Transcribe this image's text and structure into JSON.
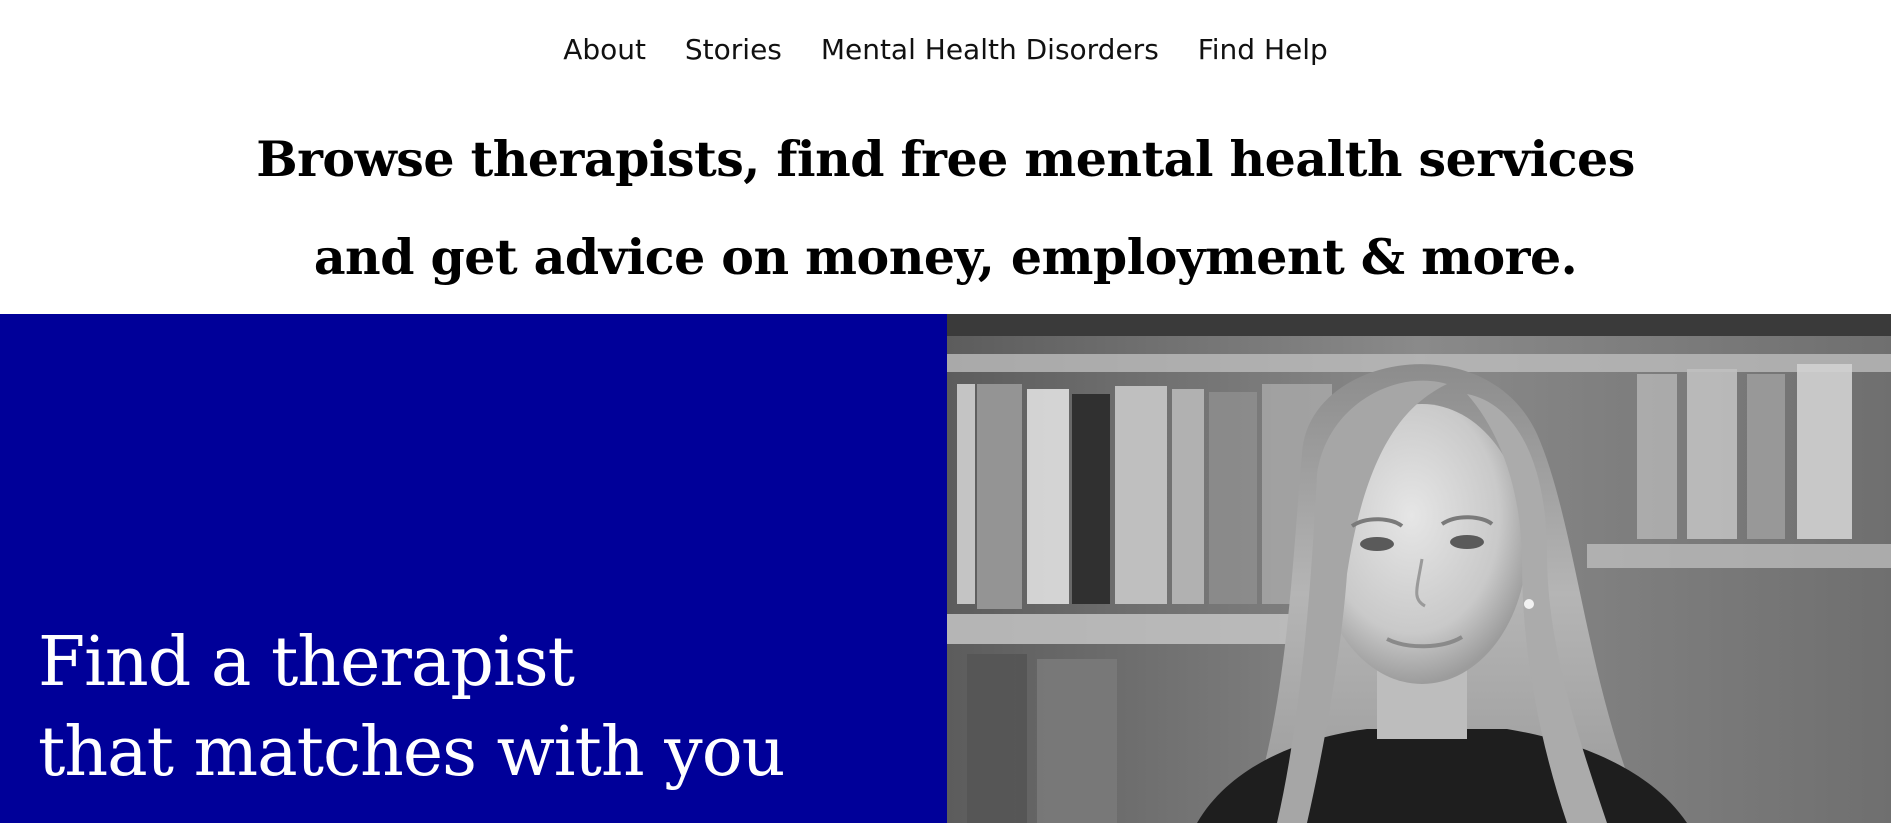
{
  "nav": {
    "items": [
      {
        "label": "About"
      },
      {
        "label": "Stories"
      },
      {
        "label": "Mental Health Disorders"
      },
      {
        "label": "Find Help"
      }
    ]
  },
  "intro": {
    "line1": "Browse therapists, find free mental health services",
    "line2": "and get advice on money, employment & more."
  },
  "hero": {
    "heading_line1": "Find a therapist",
    "heading_line2": "that matches with you",
    "panel_color": "#000099",
    "photo_description_icon": "portrait-photo"
  }
}
